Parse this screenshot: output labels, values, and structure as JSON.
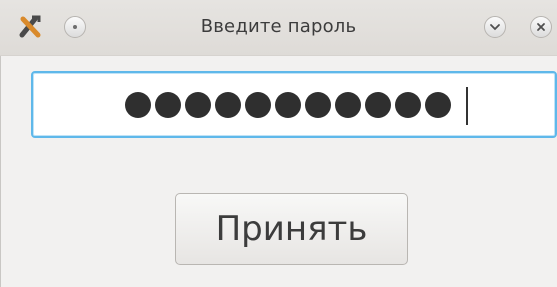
{
  "window": {
    "title": "Введите пароль",
    "controls": [
      "menu-icon",
      "minimize-icon",
      "close-icon"
    ]
  },
  "password": {
    "masked_length": 11,
    "value": "●●●●●●●●●●●",
    "focused": true
  },
  "actions": {
    "accept_label": "Принять"
  },
  "colors": {
    "focus_border": "#5fb8ea",
    "titlebar": "#e2e0dd",
    "background": "#f2f1f0"
  }
}
